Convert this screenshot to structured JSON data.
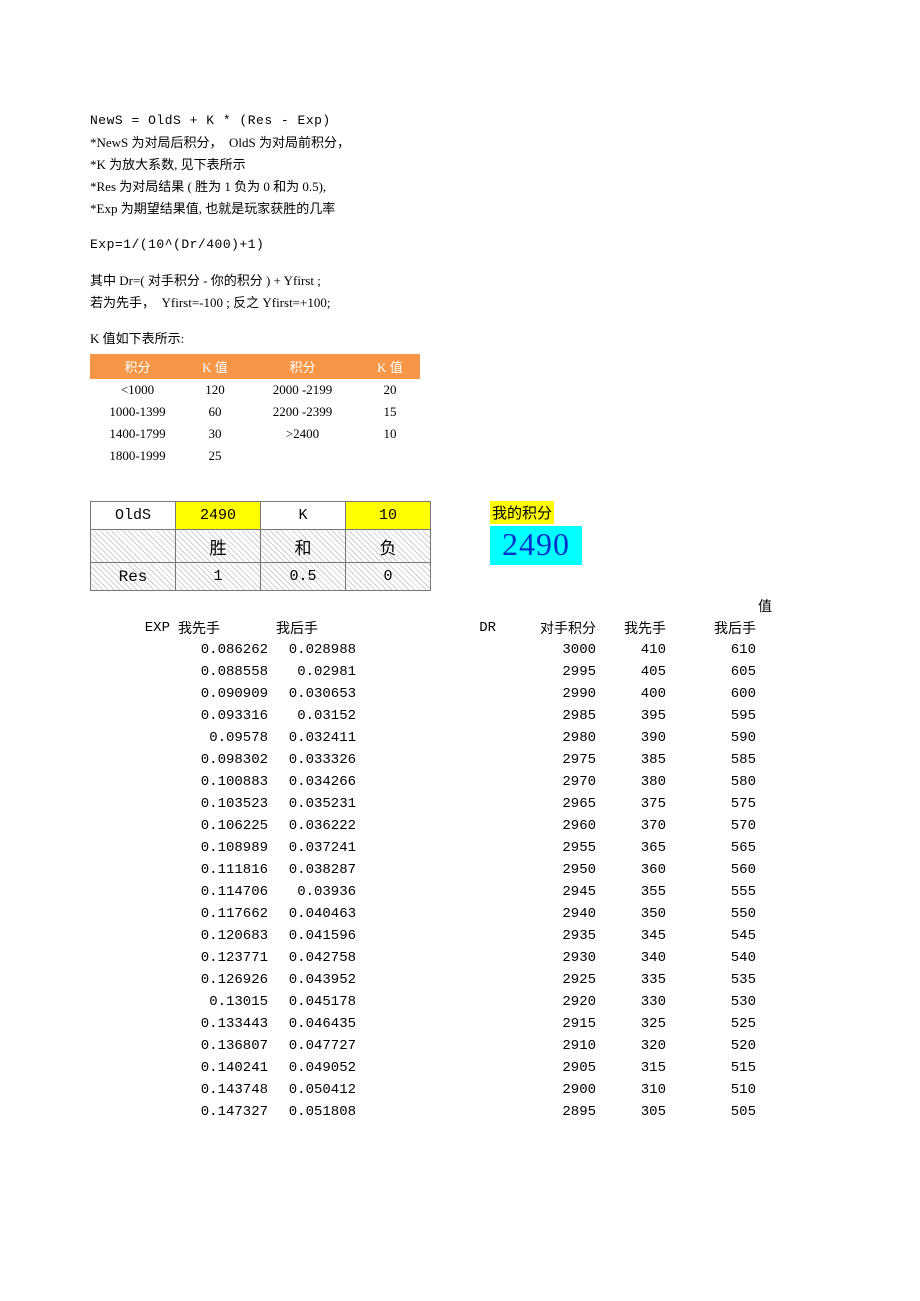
{
  "text": {
    "l1": "NewS = OldS + K * (Res - Exp)",
    "l2": "*NewS 为对局后积分，  OldS 为对局前积分，",
    "l3": "*K 为放大系数, 见下表所示",
    "l4": "*Res 为对局结果 ( 胜为 1 负为 0 和为 0.5),",
    "l5": "*Exp 为期望结果值, 也就是玩家获胜的几率",
    "l6": "Exp=1/(10^(Dr/400)+1)",
    "l7": "其中 Dr=( 对手积分 - 你的积分 ) + Yfirst ;",
    "l8": "若为先手，  Yfirst=-100 ; 反之 Yfirst=+100;",
    "l9": "K 值如下表所示:"
  },
  "ktable": {
    "headers": [
      "积分",
      "K 值",
      "积分",
      "K 值"
    ],
    "rows": [
      [
        "<1000",
        "120",
        "2000 -2199",
        "20"
      ],
      [
        "1000-1399",
        "60",
        "2200 -2399",
        "15"
      ],
      [
        "1400-1799",
        "30",
        ">2400",
        "10"
      ],
      [
        "1800-1999",
        "25",
        "",
        ""
      ]
    ]
  },
  "olds": {
    "label_olds": "OldS",
    "value_olds": "2490",
    "label_k": "K",
    "value_k": "10",
    "h_win": "胜",
    "h_draw": "和",
    "h_lose": "负",
    "label_res": "Res",
    "v_win": "1",
    "v_draw": "0.5",
    "v_lose": "0"
  },
  "score": {
    "label": "我的积分",
    "value": "2490"
  },
  "columns": {
    "exp": "EXP",
    "first": "我先手",
    "second": "我后手",
    "dr": "DR",
    "opp": "对手积分",
    "dfirst": "我先手",
    "dsecond": "我后手",
    "val": "值"
  },
  "exp_rows": [
    {
      "f": "0.086262",
      "s": "0.028988"
    },
    {
      "f": "0.088558",
      "s": "0.02981"
    },
    {
      "f": "0.090909",
      "s": "0.030653"
    },
    {
      "f": "0.093316",
      "s": "0.03152"
    },
    {
      "f": "0.09578",
      "s": "0.032411"
    },
    {
      "f": "0.098302",
      "s": "0.033326"
    },
    {
      "f": "0.100883",
      "s": "0.034266"
    },
    {
      "f": "0.103523",
      "s": "0.035231"
    },
    {
      "f": "0.106225",
      "s": "0.036222"
    },
    {
      "f": "0.108989",
      "s": "0.037241"
    },
    {
      "f": "0.111816",
      "s": "0.038287"
    },
    {
      "f": "0.114706",
      "s": "0.03936"
    },
    {
      "f": "0.117662",
      "s": "0.040463"
    },
    {
      "f": "0.120683",
      "s": "0.041596"
    },
    {
      "f": "0.123771",
      "s": "0.042758"
    },
    {
      "f": "0.126926",
      "s": "0.043952"
    },
    {
      "f": "0.13015",
      "s": "0.045178"
    },
    {
      "f": "0.133443",
      "s": "0.046435"
    },
    {
      "f": "0.136807",
      "s": "0.047727"
    },
    {
      "f": "0.140241",
      "s": "0.049052"
    },
    {
      "f": "0.143748",
      "s": "0.050412"
    },
    {
      "f": "0.147327",
      "s": "0.051808"
    }
  ],
  "dr_rows": [
    {
      "o": "3000",
      "f": "410",
      "s": "610"
    },
    {
      "o": "2995",
      "f": "405",
      "s": "605"
    },
    {
      "o": "2990",
      "f": "400",
      "s": "600"
    },
    {
      "o": "2985",
      "f": "395",
      "s": "595"
    },
    {
      "o": "2980",
      "f": "390",
      "s": "590"
    },
    {
      "o": "2975",
      "f": "385",
      "s": "585"
    },
    {
      "o": "2970",
      "f": "380",
      "s": "580"
    },
    {
      "o": "2965",
      "f": "375",
      "s": "575"
    },
    {
      "o": "2960",
      "f": "370",
      "s": "570"
    },
    {
      "o": "2955",
      "f": "365",
      "s": "565"
    },
    {
      "o": "2950",
      "f": "360",
      "s": "560"
    },
    {
      "o": "2945",
      "f": "355",
      "s": "555"
    },
    {
      "o": "2940",
      "f": "350",
      "s": "550"
    },
    {
      "o": "2935",
      "f": "345",
      "s": "545"
    },
    {
      "o": "2930",
      "f": "340",
      "s": "540"
    },
    {
      "o": "2925",
      "f": "335",
      "s": "535"
    },
    {
      "o": "2920",
      "f": "330",
      "s": "530"
    },
    {
      "o": "2915",
      "f": "325",
      "s": "525"
    },
    {
      "o": "2910",
      "f": "320",
      "s": "520"
    },
    {
      "o": "2905",
      "f": "315",
      "s": "515"
    },
    {
      "o": "2900",
      "f": "310",
      "s": "510"
    },
    {
      "o": "2895",
      "f": "305",
      "s": "505"
    }
  ]
}
